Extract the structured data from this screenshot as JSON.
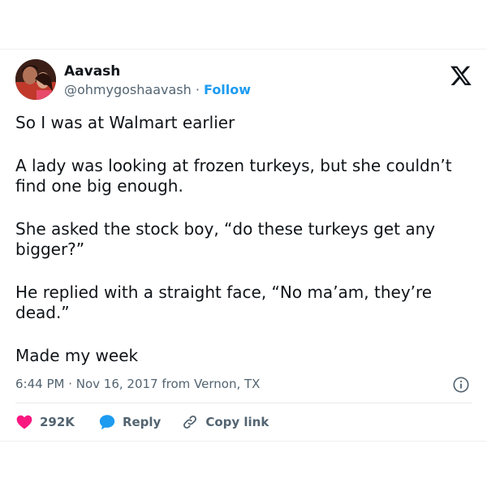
{
  "author": {
    "name": "Aavash",
    "handle": "@ohmygoshaavash",
    "separator": " · ",
    "follow_label": "Follow"
  },
  "tweet": {
    "paragraphs": [
      "So I was at Walmart earlier",
      "A lady was looking at frozen turkeys, but she couldn’t find one big enough.",
      "She asked the stock boy, “do these turkeys get any bigger?”",
      "He replied with a straight face, “No ma’am, they’re dead.”",
      "Made my week"
    ],
    "meta": "6:44 PM · Nov 16, 2017 from Vernon, TX"
  },
  "actions": {
    "like_count": "292K",
    "reply_label": "Reply",
    "copy_link_label": "Copy link"
  },
  "colors": {
    "like_red": "#f91880",
    "reply_blue": "#1d9bf0",
    "follow_blue": "#1d9bf0",
    "secondary_text": "#536471"
  },
  "icons": {
    "platform": "x-logo-icon",
    "info": "info-icon",
    "like": "heart-icon",
    "reply": "speech-bubble-icon",
    "copy": "link-icon"
  }
}
